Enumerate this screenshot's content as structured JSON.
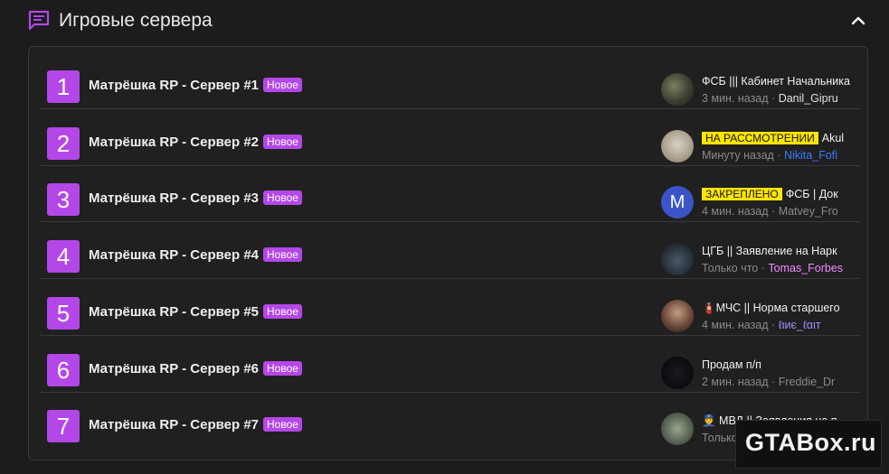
{
  "section": {
    "title": "Игровые сервера",
    "icon": "chat-icon",
    "collapse_icon": "chevron-up-icon",
    "accent_color": "#b447e8"
  },
  "forums": [
    {
      "number": "1",
      "title": "Матрёшка RP - Сервер #1",
      "badge": "Новое",
      "last_post": {
        "prefix": "",
        "title": "ФСБ ||| Кабинет Начальника",
        "time": "3 мин. назад",
        "separator": "·",
        "user": "Danil_Gipru",
        "user_color": "#e0e0e0"
      }
    },
    {
      "number": "2",
      "title": "Матрёшка RP - Сервер #2",
      "badge": "Новое",
      "last_post": {
        "prefix": "НА РАССМОТРЕНИИ",
        "title": "Akul",
        "time": "Минуту назад",
        "separator": "·",
        "user": "Nikita_Fofi",
        "user_color": "#3a7bff"
      }
    },
    {
      "number": "3",
      "title": "Матрёшка RP - Сервер #3",
      "badge": "Новое",
      "last_post": {
        "prefix": "ЗАКРЕПЛЕНО",
        "title": "ФСБ | Док",
        "time": "4 мин. назад",
        "separator": "·",
        "user": "Matvey_Fro",
        "user_color": "#8a8a8a",
        "avatar_letter": "M"
      }
    },
    {
      "number": "4",
      "title": "Матрёшка RP - Сервер #4",
      "badge": "Новое",
      "last_post": {
        "prefix": "",
        "title": "ЦГБ || Заявление на Нарк",
        "time": "Только что",
        "separator": "·",
        "user": "Tomas_Forbes",
        "user_color": "#f28cff"
      }
    },
    {
      "number": "5",
      "title": "Матрёшка RP - Сервер #5",
      "badge": "Новое",
      "last_post": {
        "prefix": "",
        "title": "🧯МЧС || Норма старшего",
        "time": "4 мин. назад",
        "separator": "·",
        "user": "ℓιиє_ℓαιт",
        "user_color": "#a58cff"
      }
    },
    {
      "number": "6",
      "title": "Матрёшка RP - Сервер #6",
      "badge": "Новое",
      "last_post": {
        "prefix": "",
        "title": "Продам п/п",
        "time": "2 мин. назад",
        "separator": "·",
        "user": "Freddie_Dr",
        "user_color": "#8a8a8a"
      }
    },
    {
      "number": "7",
      "title": "Матрёшка RP - Сервер #7",
      "badge": "Новое",
      "last_post": {
        "prefix": "",
        "title": "👮 МВД || Заявления на п",
        "time": "Только",
        "separator": "",
        "user": "",
        "user_color": "#8a8a8a"
      }
    }
  ],
  "watermark": "GTABox.ru"
}
